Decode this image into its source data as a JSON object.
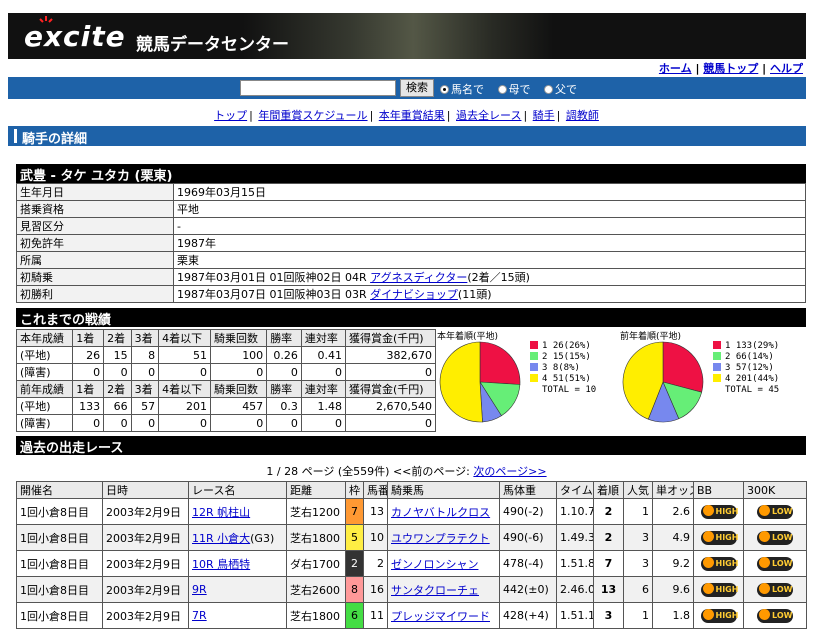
{
  "header": {
    "logo_text": "excite",
    "logo_subtitle": "競馬データセンター",
    "links": [
      "ホーム",
      "競馬トップ",
      "ヘルプ"
    ]
  },
  "search": {
    "value": "",
    "button_label": "検索",
    "options": [
      "馬名で",
      "母で",
      "父で"
    ],
    "selected_index": 0
  },
  "nav": {
    "items": [
      "トップ",
      "年間重賞スケジュール",
      "本年重賞結果",
      "過去全レース",
      "騎手",
      "調教師"
    ]
  },
  "section_title": "騎手の詳細",
  "jockey": {
    "name_header": "武豊 - タケ ユタカ (栗東)",
    "rows": [
      {
        "key": "生年月日",
        "value": "1969年03月15日"
      },
      {
        "key": "搭乗資格",
        "value": "平地"
      },
      {
        "key": "見習区分",
        "value": "-"
      },
      {
        "key": "初免許年",
        "value": "1987年"
      },
      {
        "key": "所属",
        "value": "栗東"
      },
      {
        "key": "初騎乗",
        "value": "1987年03月01日 01回阪神02日 04R ",
        "link": "アグネスディクター",
        "suffix": "(2着／15頭)"
      },
      {
        "key": "初勝利",
        "value": "1987年03月07日 01回阪神03日 03R ",
        "link": "ダイナビショップ",
        "suffix": "(11頭)"
      }
    ]
  },
  "career_title": "これまでの戦績",
  "stats": {
    "this_year": {
      "headers": [
        "本年成績",
        "1着",
        "2着",
        "3着",
        "4着以下",
        "騎乗回数",
        "勝率",
        "連対率",
        "獲得賞金(千円)"
      ],
      "rows": [
        [
          "(平地)",
          "26",
          "15",
          "8",
          "51",
          "100",
          "0.26",
          "0.41",
          "382,670"
        ],
        [
          "(障害)",
          "0",
          "0",
          "0",
          "0",
          "0",
          "0",
          "0",
          "0"
        ]
      ]
    },
    "last_year": {
      "headers": [
        "前年成績",
        "1着",
        "2着",
        "3着",
        "4着以下",
        "騎乗回数",
        "勝率",
        "連対率",
        "獲得賞金(千円)"
      ],
      "rows": [
        [
          "(平地)",
          "133",
          "66",
          "57",
          "201",
          "457",
          "0.3",
          "1.48",
          "2,670,540"
        ],
        [
          "(障害)",
          "0",
          "0",
          "0",
          "0",
          "0",
          "0",
          "0",
          "0"
        ]
      ]
    }
  },
  "chart_data": [
    {
      "type": "pie",
      "title": "本年着順(平地)",
      "categories": [
        "1",
        "2",
        "3",
        "4"
      ],
      "values": [
        26,
        15,
        8,
        51
      ],
      "labels": [
        "1 26(26%)",
        "2 15(15%)",
        "3 8(8%)",
        "4 51(51%)"
      ],
      "total_label": "TOTAL = 10",
      "colors": [
        "#ee1144",
        "#66ee77",
        "#7788ee",
        "#ffee00"
      ]
    },
    {
      "type": "pie",
      "title": "前年着順(平地)",
      "categories": [
        "1",
        "2",
        "3",
        "4"
      ],
      "values": [
        133,
        66,
        57,
        201
      ],
      "labels": [
        "1 133(29%)",
        "2 66(14%)",
        "3 57(12%)",
        "4 201(44%)"
      ],
      "total_label": "TOTAL = 45",
      "colors": [
        "#ee1144",
        "#66ee77",
        "#7788ee",
        "#ffee00"
      ]
    }
  ],
  "races_title": "過去の出走レース",
  "pager": {
    "text": "1 / 28 ページ (全559件) <<前のページ: ",
    "next_label": "次のページ>>"
  },
  "races": {
    "headers": [
      "開催名",
      "日時",
      "レース名",
      "距離",
      "枠",
      "馬番",
      "騎乗馬",
      "馬体重",
      "タイム",
      "着順",
      "人気",
      "単オッズ",
      "BB",
      "300K"
    ],
    "rows": [
      {
        "meet": "1回小倉8日目",
        "date": "2003年2月9日",
        "race": "12R 帆柱山",
        "dist": "芝右1200",
        "waku": "7",
        "waku_color": "#ff9933",
        "num": "13",
        "horse": "カノヤバトルクロス",
        "weight": "490(-2)",
        "time": "1.10.7",
        "place": "2",
        "pop": "1",
        "odds": "2.6",
        "bb": "HIGH",
        "k300": "LOW"
      },
      {
        "meet": "1回小倉8日目",
        "date": "2003年2月9日",
        "race": "11R 小倉大",
        "race_suffix": "(G3)",
        "dist": "芝右1800",
        "waku": "5",
        "waku_color": "#ffee44",
        "num": "10",
        "horse": "ユウワンプラテクト",
        "weight": "490(-6)",
        "time": "1.49.3",
        "place": "2",
        "pop": "3",
        "odds": "4.9",
        "bb": "HIGH",
        "k300": "LOW"
      },
      {
        "meet": "1回小倉8日目",
        "date": "2003年2月9日",
        "race": "10R 鳥栖特",
        "dist": "ダ右1700",
        "waku": "2",
        "waku_color": "#333333",
        "num": "2",
        "horse": "ゼンノロンシャン",
        "weight": "478(-4)",
        "time": "1.51.8",
        "place": "7",
        "pop": "3",
        "odds": "9.2",
        "bb": "HIGH",
        "k300": "LOW"
      },
      {
        "meet": "1回小倉8日目",
        "date": "2003年2月9日",
        "race": "9R",
        "dist": "芝右2600",
        "waku": "8",
        "waku_color": "#ff9999",
        "num": "16",
        "horse": "サンタクローチェ",
        "weight": "442(±0)",
        "time": "2.46.0",
        "place": "13",
        "pop": "6",
        "odds": "9.6",
        "bb": "HIGH",
        "k300": "LOW"
      },
      {
        "meet": "1回小倉8日目",
        "date": "2003年2月9日",
        "race": "7R",
        "dist": "芝右1800",
        "waku": "6",
        "waku_color": "#44dd44",
        "num": "11",
        "horse": "プレッジマイワード",
        "weight": "428(+4)",
        "time": "1.51.1",
        "place": "3",
        "pop": "1",
        "odds": "1.8",
        "bb": "HIGH",
        "k300": "LOW"
      }
    ]
  }
}
